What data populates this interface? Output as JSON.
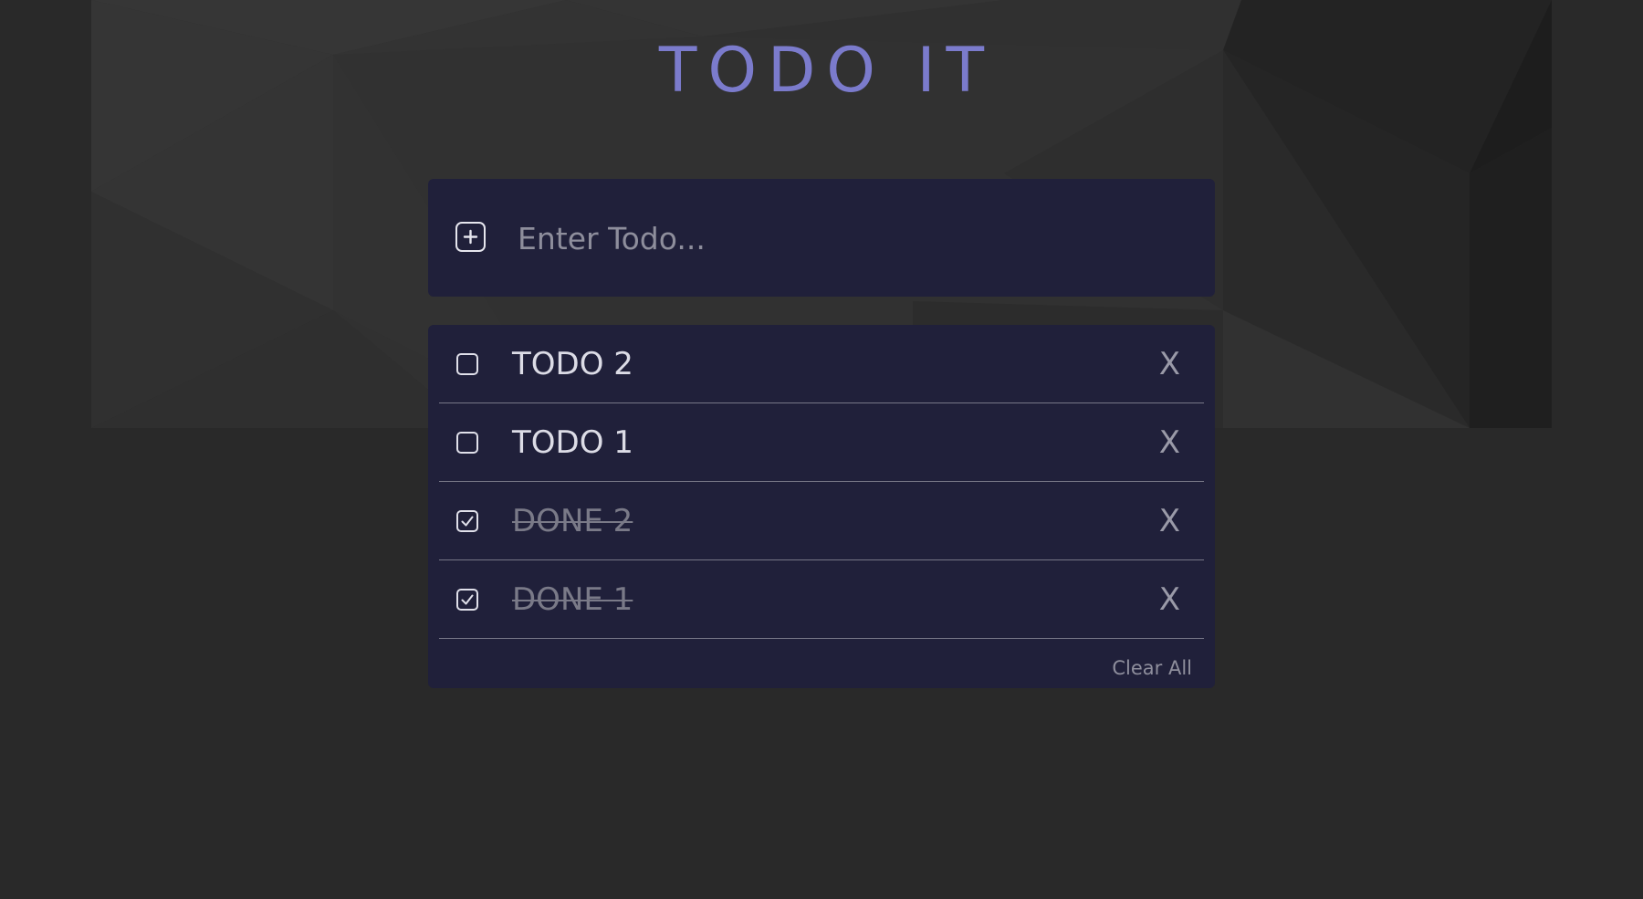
{
  "app": {
    "title": "TODO IT"
  },
  "input": {
    "placeholder": "Enter Todo...",
    "value": "",
    "add_icon": "plus-square-icon"
  },
  "todos": [
    {
      "text": "TODO 2",
      "done": false,
      "delete_label": "X"
    },
    {
      "text": "TODO 1",
      "done": false,
      "delete_label": "X"
    },
    {
      "text": "DONE 2",
      "done": true,
      "delete_label": "X"
    },
    {
      "text": "DONE 1",
      "done": true,
      "delete_label": "X"
    }
  ],
  "footer": {
    "clear_all_label": "Clear All"
  },
  "colors": {
    "page_background": "#292929",
    "card_background": "#20203a",
    "title_accent": "#7b7bcc",
    "done_text": "#7a7a88"
  }
}
